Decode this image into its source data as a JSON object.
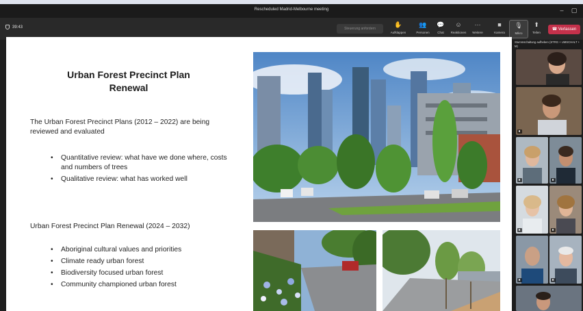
{
  "window": {
    "title": "Rescheduled Madrid-Melbourne meeting"
  },
  "toolbar": {
    "timer": "39:43",
    "share_label": "Steuerung anfordern",
    "tools": [
      {
        "icon": "raise-hand-icon",
        "label": "Aufklappen"
      },
      {
        "icon": "people-icon",
        "label": "Personen"
      },
      {
        "icon": "chat-icon",
        "label": "Chat"
      },
      {
        "icon": "reactions-icon",
        "label": "Reaktionen"
      },
      {
        "icon": "more-icon",
        "label": "Weitere"
      },
      {
        "icon": "camera-icon",
        "label": "Kamera"
      },
      {
        "icon": "mic-icon",
        "label": "Mikro"
      },
      {
        "icon": "share-icon",
        "label": "Teilen"
      }
    ],
    "leave_label": "Verlassen",
    "accent": "#c4314b"
  },
  "slide": {
    "title_line1": "Urban Forest Precinct Plan",
    "title_line2": "Renewal",
    "intro": "The Urban Forest Precinct Plans (2012 – 2022) are being reviewed and evaluated",
    "review_bullets": [
      "Quantitative review: what have we done where, costs and numbers of trees",
      "Qualitative review:  what has worked well"
    ],
    "renewal_heading": "Urban Forest Precinct Plan Renewal (2024 – 2032)",
    "renewal_bullets": [
      "Aboriginal cultural values and priorities",
      "Climate ready urban forest",
      "Biodiversity focused urban forest",
      "Community championed urban forest"
    ]
  },
  "sidebar": {
    "hint": "Stummschaltung aufheben (STRG + UMSCHALT + M)"
  }
}
